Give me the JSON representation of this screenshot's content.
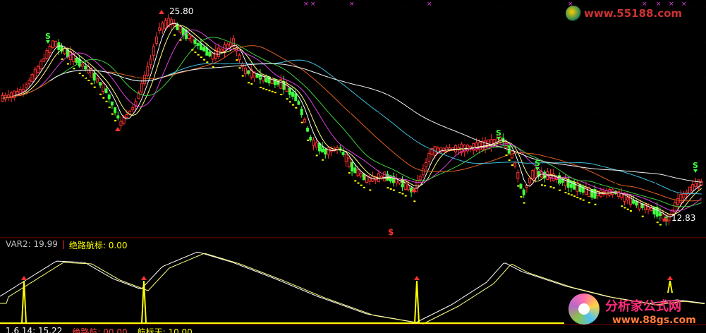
{
  "chart_data": [
    {
      "type": "candlestick",
      "panel": "main",
      "price_high_label": "25.80",
      "price_low_label": "12.83",
      "top_watermark": "www.55188.com",
      "buy_sell_marker": "$",
      "series": [
        {
          "name": "MA-white",
          "color": "#ffffff"
        },
        {
          "name": "MA-yellow",
          "color": "#ffff80"
        },
        {
          "name": "MA-magenta",
          "color": "#e040e0"
        },
        {
          "name": "MA-green",
          "color": "#40d040"
        },
        {
          "name": "MA-orange",
          "color": "#e06020"
        },
        {
          "name": "MA-cyan",
          "color": "#40c0e0"
        },
        {
          "name": "MA-long",
          "color": "#f0f0f0"
        }
      ]
    },
    {
      "type": "line",
      "panel": "indicator",
      "legend": [
        {
          "label": "VAR2: 19.99",
          "color": "#c0c0c0"
        },
        {
          "label": "绝路航标: 0.00",
          "color": "#ffff00"
        }
      ],
      "series": [
        {
          "name": "",
          "color": "#ffffff"
        },
        {
          "name": "",
          "color": "#ffff80"
        }
      ],
      "bottom_legend": [
        {
          "label": "1.6 14: 15.22",
          "color": "#ffffff"
        },
        {
          "label": "绝路航: 00.00",
          "color": "#ff4040"
        },
        {
          "label": "航标天: 10.00",
          "color": "#ffff00"
        }
      ]
    }
  ],
  "watermark": {
    "brand": "分析家公式网",
    "url": "www.88gs.com"
  },
  "colors": {
    "up": "#ff3030",
    "down": "#40ff40",
    "axis": "#800000",
    "grid": "#400000"
  }
}
